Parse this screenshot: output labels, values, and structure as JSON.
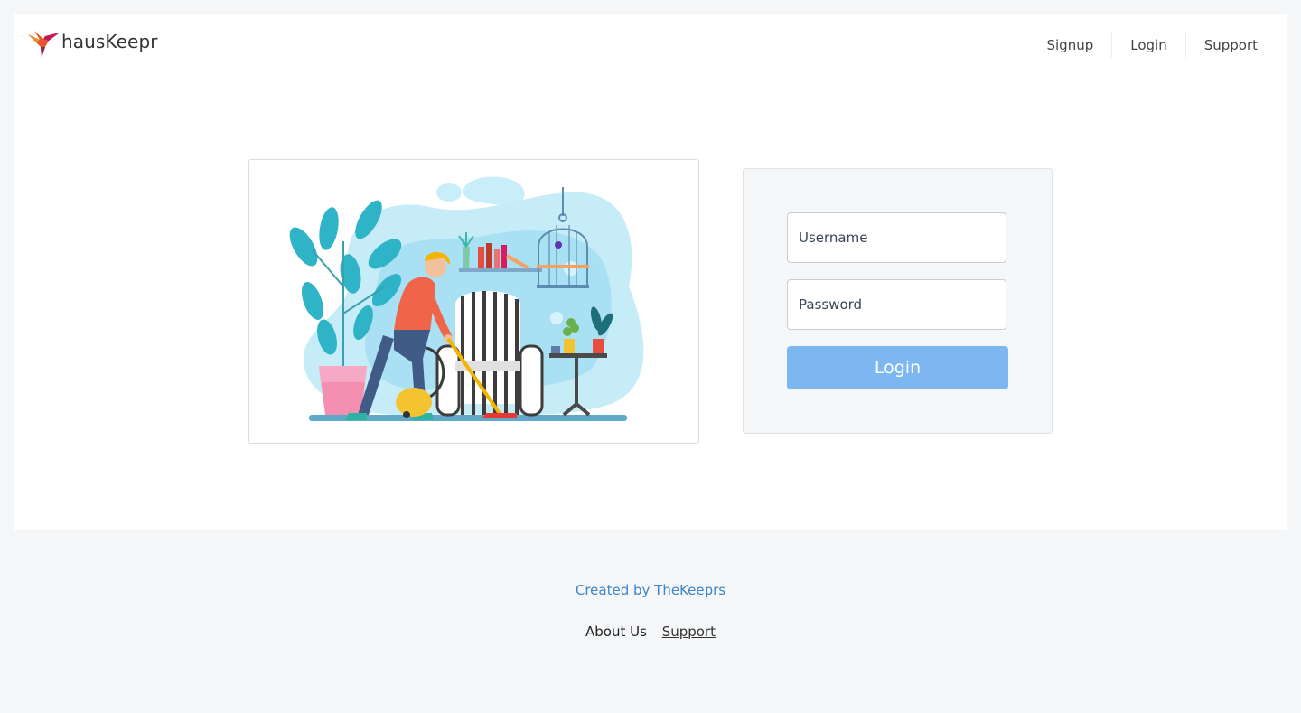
{
  "brand": {
    "name": "hausKeepr",
    "logo_icon": "hummingbird-logo-icon"
  },
  "nav": {
    "items": [
      {
        "label": "Signup"
      },
      {
        "label": "Login"
      },
      {
        "label": "Support"
      }
    ]
  },
  "login_form": {
    "username_placeholder": "Username",
    "password_placeholder": "Password",
    "submit_label": "Login",
    "submit_color": "#7db7f2"
  },
  "illustration": {
    "icon": "person-vacuuming-illustration"
  },
  "footer": {
    "credit": "Created by TheKeeprs",
    "links": [
      {
        "label": "About Us"
      },
      {
        "label": "Support"
      }
    ],
    "credit_color": "#3d85c6"
  }
}
